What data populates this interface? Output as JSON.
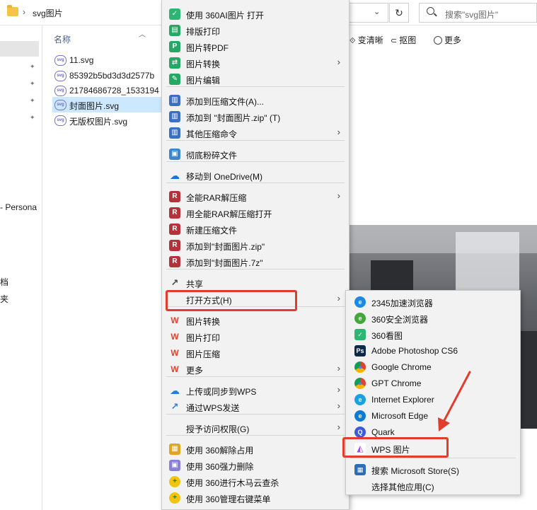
{
  "address": {
    "path": "svg图片",
    "search_placeholder": "搜索\"svg图片\""
  },
  "toolbar": {
    "item1": "变清晰",
    "item2": "抠图",
    "item3": "更多"
  },
  "nav": {
    "item1": "- Persona",
    "item2": "档",
    "item3": "夹"
  },
  "columns": {
    "name": "名称"
  },
  "files": [
    {
      "name": "11.svg",
      "selected": false
    },
    {
      "name": "85392b5bd3d3d2577b",
      "selected": false
    },
    {
      "name": "21784686728_1533194",
      "selected": false
    },
    {
      "name": "封面图片.svg",
      "selected": true
    },
    {
      "name": "无版权图片.svg",
      "selected": false
    }
  ],
  "menu": {
    "items": [
      {
        "label": "使用 360AI图片 打开",
        "icon": "ai-image-icon",
        "color": "#2bb673",
        "glyph": "✓"
      },
      {
        "label": "排版打印",
        "icon": "print-icon",
        "color": "#25a865",
        "glyph": "▤"
      },
      {
        "label": "图片转PDF",
        "icon": "pdf-icon",
        "color": "#25a865",
        "glyph": "P"
      },
      {
        "label": "图片转换",
        "icon": "convert-icon",
        "color": "#25a865",
        "glyph": "⇄"
      },
      {
        "label": "图片编辑",
        "icon": "edit-icon",
        "color": "#25a865",
        "glyph": "✎"
      },
      {
        "label": "添加到压缩文件(A)...",
        "icon": "archive-icon",
        "color": "#3b6fc4",
        "glyph": "▥"
      },
      {
        "label": "添加到 \"封面图片.zip\" (T)",
        "icon": "archive-zip-icon",
        "color": "#3b6fc4",
        "glyph": "▥"
      },
      {
        "label": "其他压缩命令",
        "icon": "archive-more-icon",
        "color": "#3b6fc4",
        "glyph": "▥"
      },
      {
        "label": "彻底粉碎文件",
        "icon": "shred-icon",
        "color": "#3b86d1",
        "glyph": "▣"
      },
      {
        "label": "移动到 OneDrive(M)",
        "icon": "onedrive-icon",
        "color": "#1a73d8",
        "glyph": "☁"
      },
      {
        "label": "全能RAR解压缩",
        "icon": "rar-icon",
        "color": "#b5323a",
        "glyph": "R"
      },
      {
        "label": "用全能RAR解压缩打开",
        "icon": "rar-open-icon",
        "color": "#b5323a",
        "glyph": "R"
      },
      {
        "label": "新建压缩文件",
        "icon": "rar-new-icon",
        "color": "#b5323a",
        "glyph": "R"
      },
      {
        "label": "添加到\"封面图片.zip\"",
        "icon": "rar-zip-icon",
        "color": "#b5323a",
        "glyph": "R"
      },
      {
        "label": "添加到\"封面图片.7z\"",
        "icon": "rar-7z-icon",
        "color": "#b5323a",
        "glyph": "R"
      },
      {
        "label": "共享",
        "icon": "share-icon",
        "color": "#555555",
        "glyph": "↗"
      },
      {
        "label": "打开方式(H)",
        "icon": "",
        "color": "",
        "glyph": ""
      },
      {
        "label": "图片转换",
        "icon": "wps-convert-icon",
        "color": "#e0432d",
        "glyph": "W"
      },
      {
        "label": "图片打印",
        "icon": "wps-print-icon",
        "color": "#e0432d",
        "glyph": "W"
      },
      {
        "label": "图片压缩",
        "icon": "wps-compress-icon",
        "color": "#e0432d",
        "glyph": "W"
      },
      {
        "label": "更多",
        "icon": "wps-more-icon",
        "color": "#e0432d",
        "glyph": "W"
      },
      {
        "label": "上传或同步到WPS",
        "icon": "wps-cloud-icon",
        "color": "#2b7cd8",
        "glyph": "☁"
      },
      {
        "label": "通过WPS发送",
        "icon": "wps-send-icon",
        "color": "#2b7cd8",
        "glyph": "↗"
      },
      {
        "label": "授予访问权限(G)",
        "icon": "",
        "color": "",
        "glyph": ""
      },
      {
        "label": "使用 360解除占用",
        "icon": "unlock-icon",
        "color": "#e2a521",
        "glyph": "▦"
      },
      {
        "label": "使用 360强力删除",
        "icon": "force-delete-icon",
        "color": "#8a7fd6",
        "glyph": "▣"
      },
      {
        "label": "使用 360进行木马云查杀",
        "icon": "trojan-scan-icon",
        "color": "#39a935",
        "glyph": "+"
      },
      {
        "label": "使用 360管理右键菜单",
        "icon": "menu-manage-icon",
        "color": "#39a935",
        "glyph": "+"
      }
    ]
  },
  "submenu": {
    "items": [
      {
        "label": "2345加速浏览器",
        "icon": "2345-browser-icon",
        "color": "#1e88e5",
        "glyph": "e"
      },
      {
        "label": "360安全浏览器",
        "icon": "360-browser-icon",
        "color": "#43a83a",
        "glyph": "e"
      },
      {
        "label": "360看图",
        "icon": "360-viewer-icon",
        "color": "#2bb673",
        "glyph": "✓"
      },
      {
        "label": "Adobe Photoshop CS6",
        "icon": "photoshop-icon",
        "color": "#0b2a4a",
        "glyph": "Ps"
      },
      {
        "label": "Google Chrome",
        "icon": "chrome-icon",
        "color": "#db4437",
        "glyph": "●"
      },
      {
        "label": "GPT Chrome",
        "icon": "gpt-chrome-icon",
        "color": "#0f9d58",
        "glyph": "●"
      },
      {
        "label": "Internet Explorer",
        "icon": "ie-icon",
        "color": "#1ba1e2",
        "glyph": "e"
      },
      {
        "label": "Microsoft Edge",
        "icon": "edge-icon",
        "color": "#0c7bd3",
        "glyph": "e"
      },
      {
        "label": "Quark",
        "icon": "quark-icon",
        "color": "#3b5bdb",
        "glyph": "Q"
      },
      {
        "label": "WPS 图片",
        "icon": "wps-image-icon",
        "color": "#ffffff",
        "glyph": "◭"
      },
      {
        "label": "搜索 Microsoft Store(S)",
        "icon": "store-icon",
        "color": "#2f6db4",
        "glyph": "▦"
      },
      {
        "label": "选择其他应用(C)",
        "icon": "",
        "color": "",
        "glyph": ""
      }
    ]
  },
  "colors": {
    "highlight": "#e23c2e",
    "menu_bg": "#f2f2f2",
    "selection": "#cce8ff"
  }
}
